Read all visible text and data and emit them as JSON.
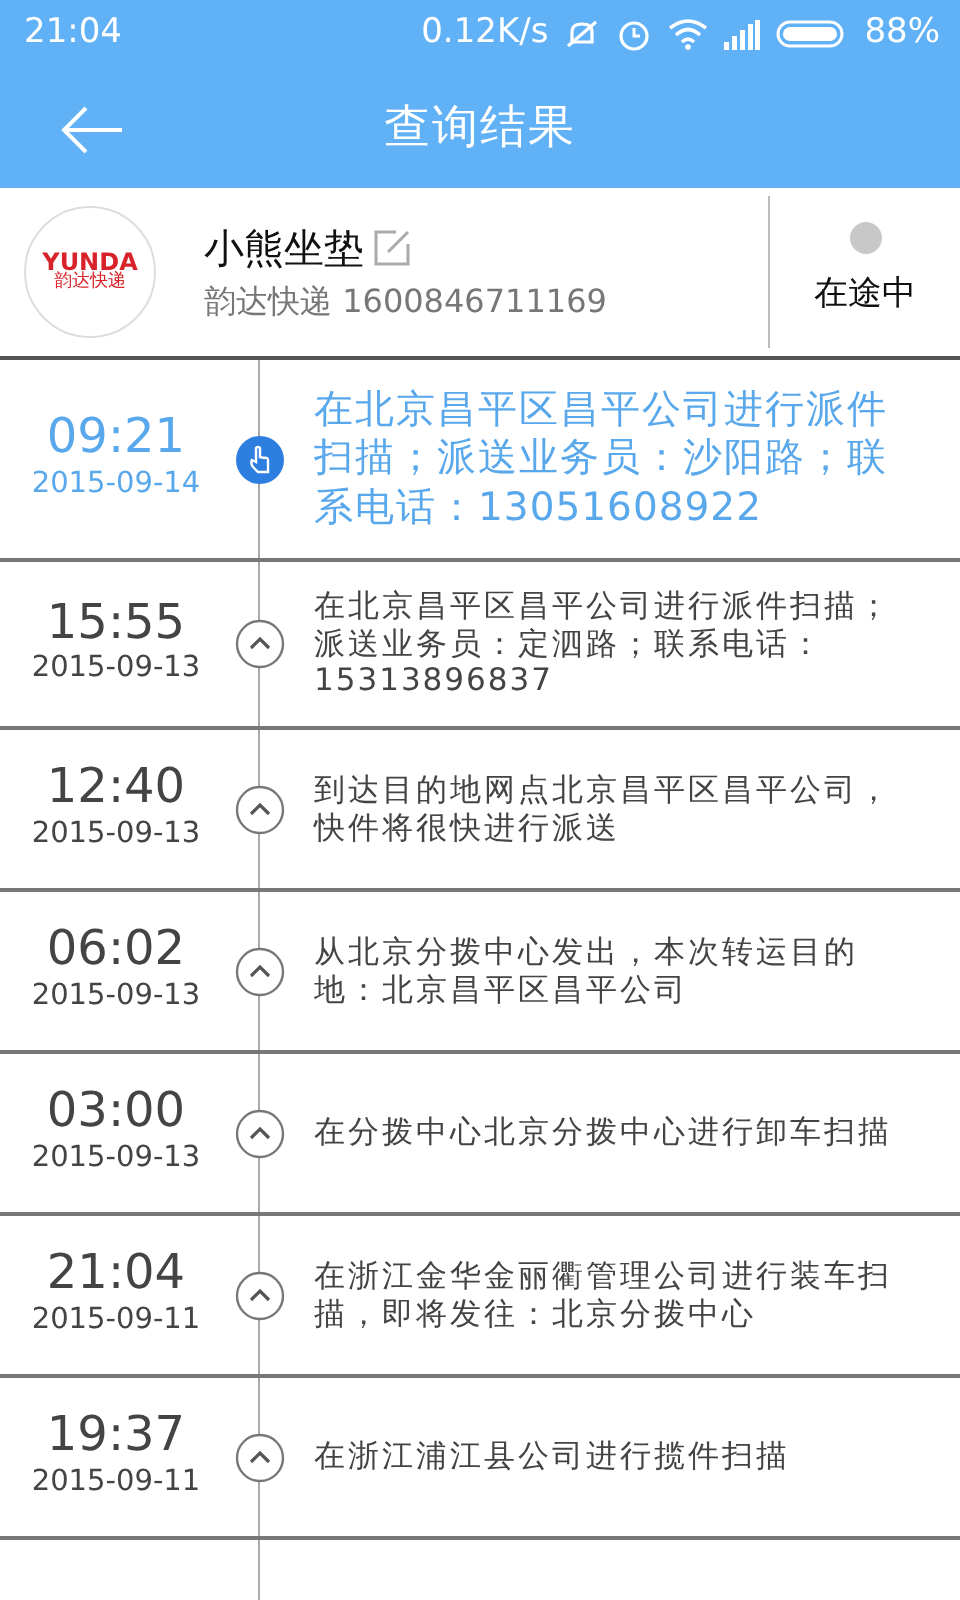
{
  "status_bar": {
    "time": "21:04",
    "speed": "0.12K/s",
    "battery": "88%"
  },
  "app_bar": {
    "title": "查询结果"
  },
  "package": {
    "logo_text": "YUNDA",
    "logo_subtext": "韵达快递",
    "name": "小熊坐垫",
    "carrier_number": "韵达快递 1600846711169",
    "status": "在途中"
  },
  "events": [
    {
      "time": "09:21",
      "date": "2015-09-14",
      "text": "在北京昌平区昌平公司进行派件扫描；派送业务员：沙阳路；联系电话：13051608922",
      "current": true
    },
    {
      "time": "15:55",
      "date": "2015-09-13",
      "text": "在北京昌平区昌平公司进行派件扫描；派送业务员：定泗路；联系电话：15313896837",
      "current": false
    },
    {
      "time": "12:40",
      "date": "2015-09-13",
      "text": "到达目的地网点北京昌平区昌平公司，快件将很快进行派送",
      "current": false
    },
    {
      "time": "06:02",
      "date": "2015-09-13",
      "text": "从北京分拨中心发出，本次转运目的地：北京昌平区昌平公司",
      "current": false
    },
    {
      "time": "03:00",
      "date": "2015-09-13",
      "text": "在分拨中心北京分拨中心进行卸车扫描",
      "current": false
    },
    {
      "time": "21:04",
      "date": "2015-09-11",
      "text": "在浙江金华金丽衢管理公司进行装车扫描，即将发往：北京分拨中心",
      "current": false
    },
    {
      "time": "19:37",
      "date": "2015-09-11",
      "text": "在浙江浦江县公司进行揽件扫描",
      "current": false
    }
  ]
}
